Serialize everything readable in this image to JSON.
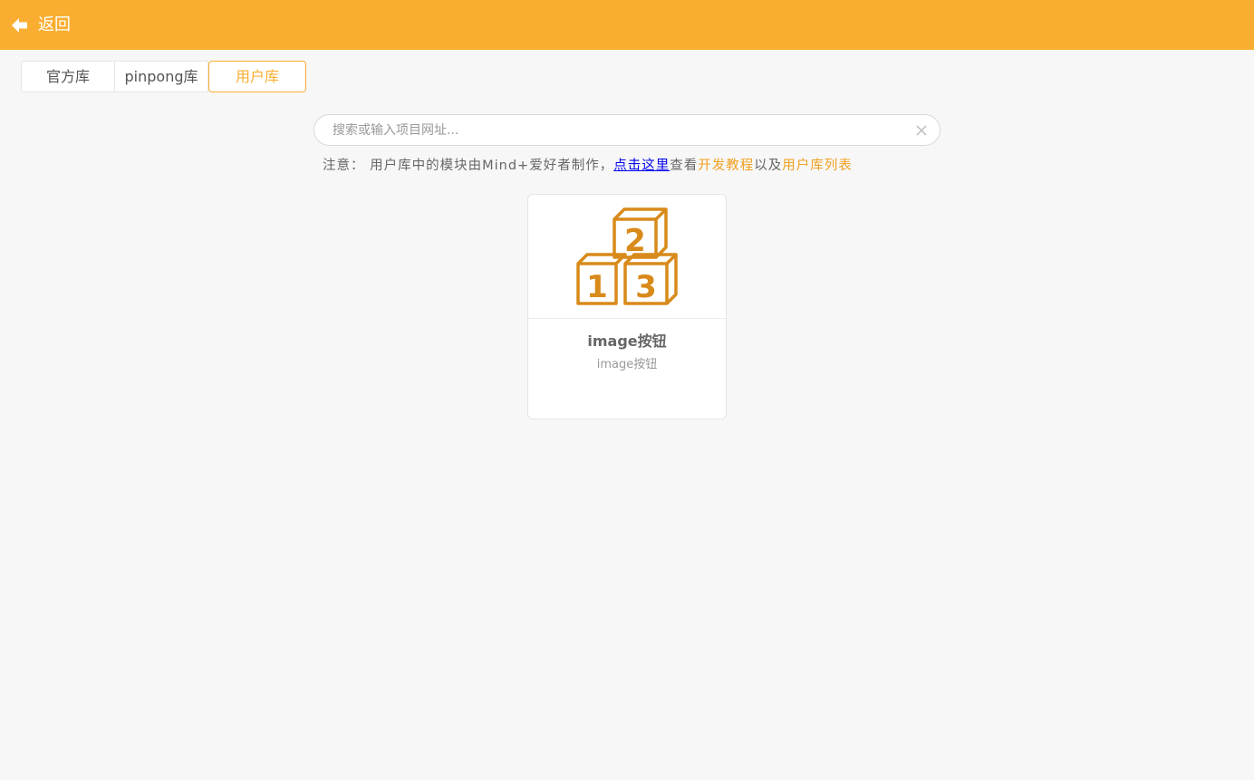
{
  "header": {
    "back_label": "返回",
    "color": "#f9ae31"
  },
  "tabs": [
    {
      "label": "官方库",
      "active": false
    },
    {
      "label": "pinpong库",
      "active": false
    },
    {
      "label": "用户库",
      "active": true
    }
  ],
  "search": {
    "placeholder": "搜索或输入项目网址...",
    "value": ""
  },
  "notice": {
    "prefix": "注意：  用户库中的模块由Mind+爱好者制作，",
    "click_here": "点击这里",
    "view": "查看",
    "dev_tutorial": "开发教程",
    "and": "以及",
    "user_lib_list": "用户库列表"
  },
  "cards": [
    {
      "title": "image按钮",
      "description": "image按钮",
      "icon": "number-blocks-icon",
      "icon_color": "#d88a1a"
    }
  ]
}
